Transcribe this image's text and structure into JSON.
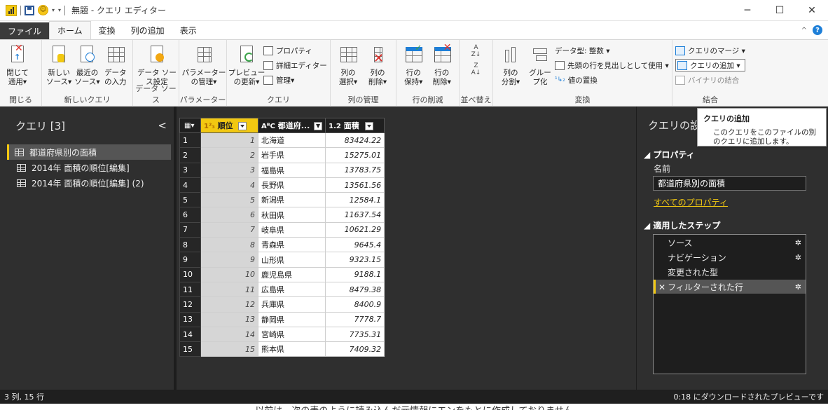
{
  "window": {
    "title": "無題 - クエリ エディター",
    "minimize": "─",
    "maximize": "☐",
    "close": "✕"
  },
  "tabs": [
    {
      "label": "ファイル"
    },
    {
      "label": "ホーム"
    },
    {
      "label": "変換"
    },
    {
      "label": "列の追加"
    },
    {
      "label": "表示"
    }
  ],
  "ribbon": {
    "close_group": {
      "label": "閉じる",
      "close_apply": "閉じて\n適用▾"
    },
    "newquery_group": {
      "label": "新しいクエリ",
      "new_source": "新しい\nソース▾",
      "recent_sources": "最近の\nソース▾",
      "enter_data": "データ\nの入力"
    },
    "datasource_group": {
      "label": "データ ソース",
      "settings": "データ ソー\nス設定"
    },
    "params_group": {
      "label": "パラメーター",
      "manage_params": "パラメーター\nの管理▾"
    },
    "query_group": {
      "label": "クエリ",
      "preview_refresh": "プレビュー\nの更新▾",
      "properties": "プロパティ",
      "advanced_editor": "詳細エディター",
      "manage": "管理▾"
    },
    "columns_group": {
      "label": "列の管理",
      "choose_columns": "列の\n選択▾",
      "remove_columns": "列の\n削除▾"
    },
    "rows_group": {
      "label": "行の削減",
      "keep_rows": "行の\n保持▾",
      "remove_rows": "行の\n削除▾"
    },
    "sort_group": {
      "label": "並べ替え"
    },
    "transform_group": {
      "label": "変換",
      "split_column": "列の\n分割▾",
      "group_by": "グルー\nプ化",
      "data_type": "データ型: 整数 ▾",
      "use_first_row": "先頭の行を見出しとして使用 ▾",
      "replace_values": "値の置換"
    },
    "combine_group": {
      "label": "結合",
      "merge_queries": "クエリのマージ ▾",
      "append_queries": "クエリの追加 ▾",
      "combine_binaries": "バイナリの結合"
    }
  },
  "queries_panel": {
    "header": "クエリ [3]",
    "collapse": "<",
    "items": [
      {
        "label": "都道府県別の面積"
      },
      {
        "label": "2014年 面積の順位[編集]"
      },
      {
        "label": "2014年 面積の順位[編集] (2)"
      }
    ]
  },
  "table": {
    "columns": [
      {
        "type": "1²₃",
        "name": "順位"
      },
      {
        "type": "AᴮC",
        "name": "都道府..."
      },
      {
        "type": "1.2",
        "name": "面積"
      }
    ],
    "rows": [
      {
        "n": "1",
        "rank": "1",
        "pref": "北海道",
        "area": "83424.22"
      },
      {
        "n": "2",
        "rank": "2",
        "pref": "岩手県",
        "area": "15275.01"
      },
      {
        "n": "3",
        "rank": "3",
        "pref": "福島県",
        "area": "13783.75"
      },
      {
        "n": "4",
        "rank": "4",
        "pref": "長野県",
        "area": "13561.56"
      },
      {
        "n": "5",
        "rank": "5",
        "pref": "新潟県",
        "area": "12584.1"
      },
      {
        "n": "6",
        "rank": "6",
        "pref": "秋田県",
        "area": "11637.54"
      },
      {
        "n": "7",
        "rank": "7",
        "pref": "岐阜県",
        "area": "10621.29"
      },
      {
        "n": "8",
        "rank": "8",
        "pref": "青森県",
        "area": "9645.4"
      },
      {
        "n": "9",
        "rank": "9",
        "pref": "山形県",
        "area": "9323.15"
      },
      {
        "n": "10",
        "rank": "10",
        "pref": "鹿児島県",
        "area": "9188.1"
      },
      {
        "n": "11",
        "rank": "11",
        "pref": "広島県",
        "area": "8479.38"
      },
      {
        "n": "12",
        "rank": "12",
        "pref": "兵庫県",
        "area": "8400.9"
      },
      {
        "n": "13",
        "rank": "13",
        "pref": "静岡県",
        "area": "7778.7"
      },
      {
        "n": "14",
        "rank": "14",
        "pref": "宮崎県",
        "area": "7735.31"
      },
      {
        "n": "15",
        "rank": "15",
        "pref": "熊本県",
        "area": "7409.32"
      }
    ]
  },
  "settings_panel": {
    "title": "クエリの設",
    "properties_section": "◢ プロパティ",
    "name_label": "名前",
    "name_value": "都道府県別の面積",
    "all_properties": "すべてのプロパティ",
    "steps_section": "◢ 適用したステップ",
    "steps": [
      {
        "label": "ソース",
        "gear": "✲"
      },
      {
        "label": "ナビゲーション",
        "gear": "✲"
      },
      {
        "label": "変更された型",
        "gear": ""
      },
      {
        "label": "フィルターされた行",
        "gear": "✲"
      }
    ]
  },
  "tooltip": {
    "title": "クエリの追加",
    "description": "このクエリをこのファイルの別のクエリに追加します。"
  },
  "status": {
    "left": "3 列, 15 行",
    "right": "0:18 にダウンロードされたプレビューです"
  },
  "caption": "以前は、次の表のように読み込んだ元情報にエンをもとに作成しておりません",
  "colors": {
    "accent": "#f2c811",
    "dark_panel": "#2f2f2f",
    "ribbon": "#f6f6f6",
    "link": "#f2c811"
  }
}
